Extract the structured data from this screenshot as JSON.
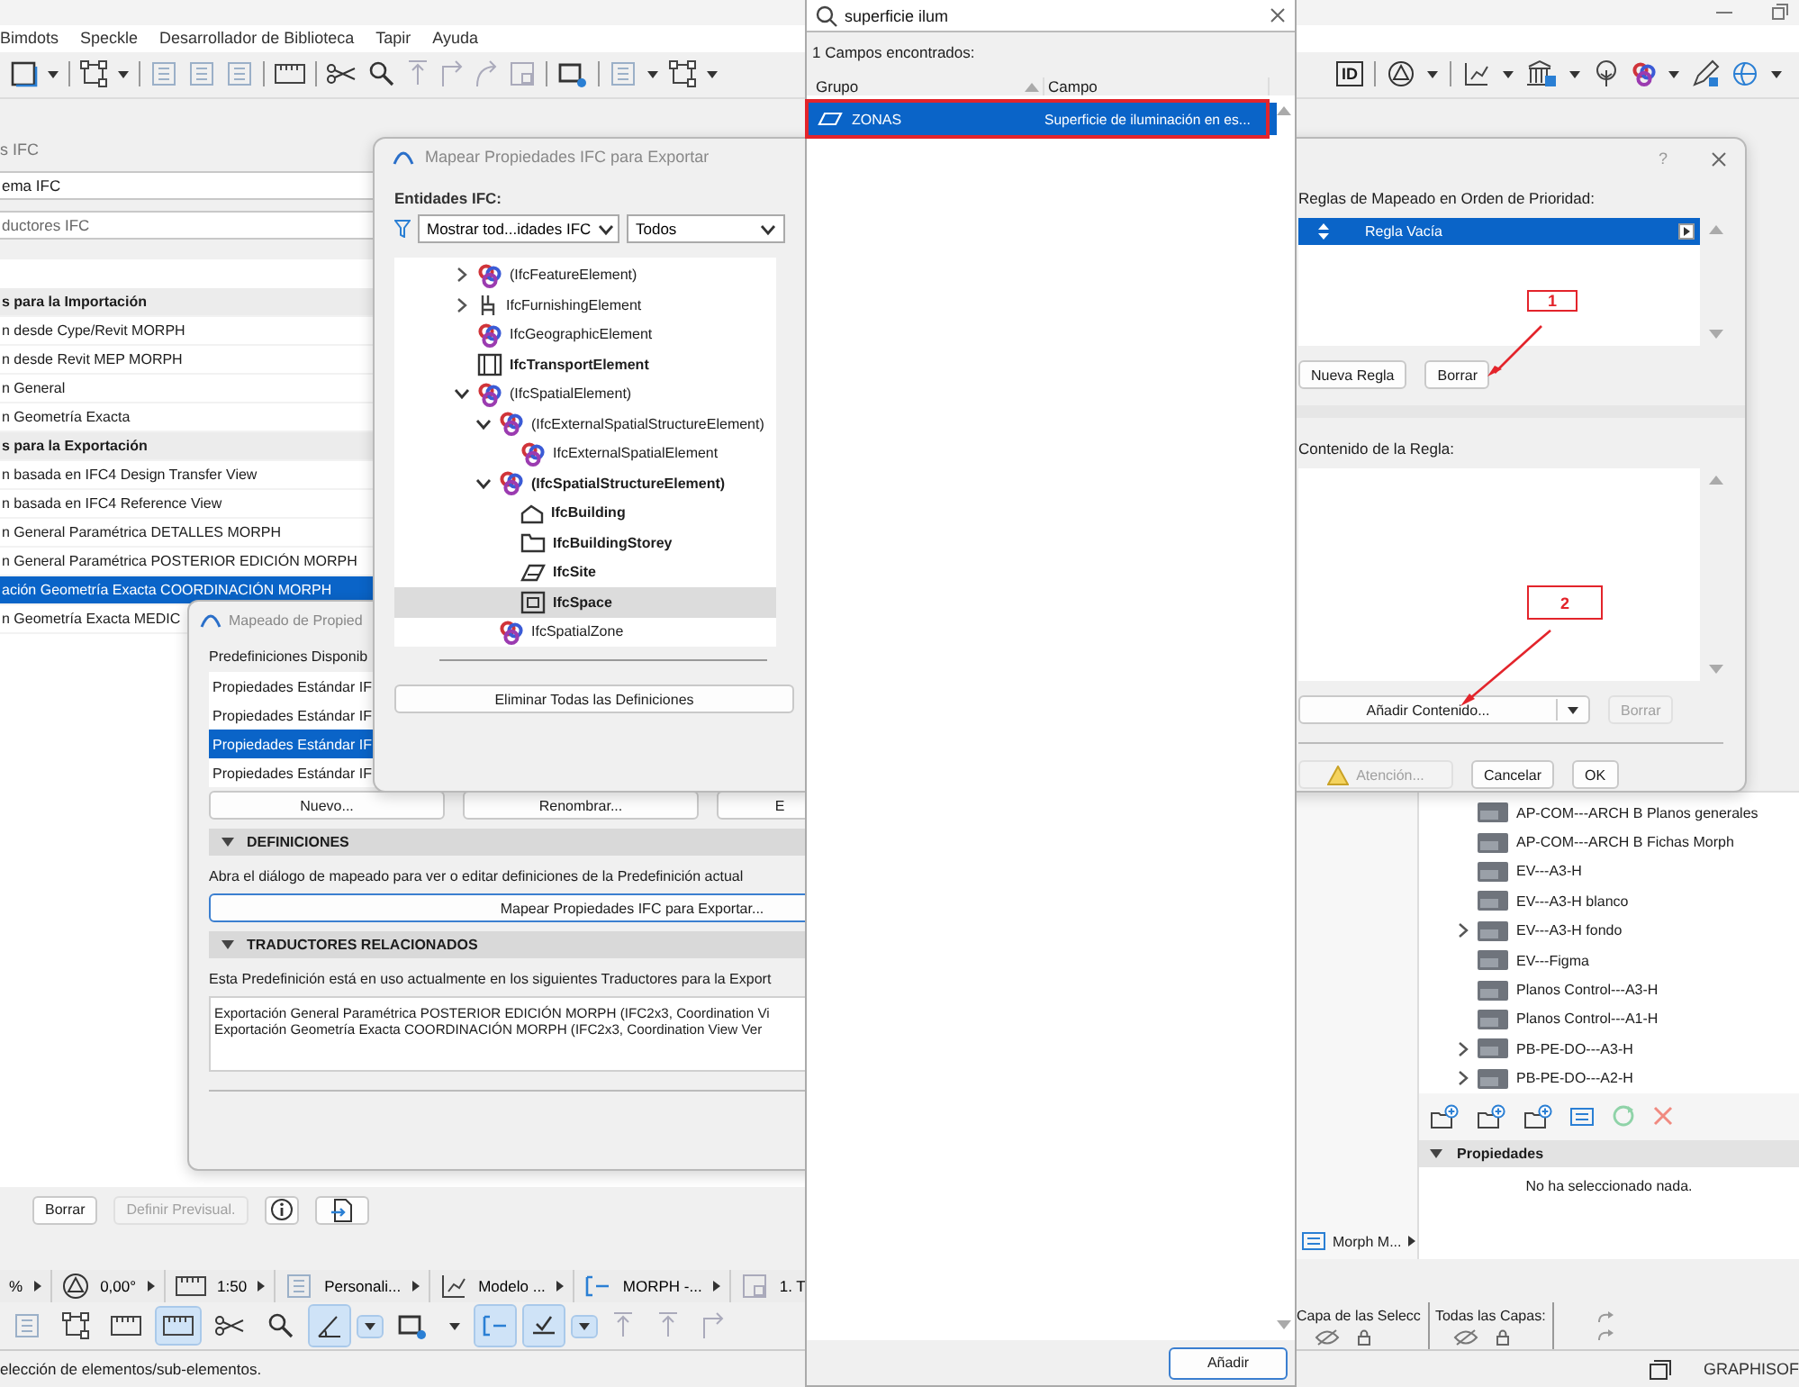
{
  "menu_bar": {
    "items": [
      "Bimdots",
      "Speckle",
      "Desarrollador de Biblioteca",
      "Tapir",
      "Ayuda"
    ]
  },
  "toolbar": {
    "id_button": "ID"
  },
  "ifc_panel": {
    "title": "s IFC",
    "scheme_field": "ema IFC",
    "translators_field": "ductores IFC",
    "rows": [
      {
        "text": "s para la Importación",
        "kind": "header",
        "selected": false
      },
      {
        "text": "n desde Cype/Revit MORPH",
        "kind": "item",
        "selected": false
      },
      {
        "text": "n desde Revit MEP MORPH",
        "kind": "item",
        "selected": false
      },
      {
        "text": "n General",
        "kind": "item",
        "selected": false
      },
      {
        "text": "n Geometría Exacta",
        "kind": "item",
        "selected": false
      },
      {
        "text": "s para la Exportación",
        "kind": "header",
        "selected": false
      },
      {
        "text": "n basada en IFC4 Design Transfer View",
        "kind": "item",
        "selected": false
      },
      {
        "text": "n basada en IFC4 Reference View",
        "kind": "item",
        "selected": false
      },
      {
        "text": "n General Paramétrica DETALLES MORPH",
        "kind": "item",
        "selected": false
      },
      {
        "text": "n General Paramétrica POSTERIOR EDICIÓN MORPH",
        "kind": "item",
        "selected": false
      },
      {
        "text": "ación Geometría Exacta COORDINACIÓN MORPH",
        "kind": "item",
        "selected": true
      },
      {
        "text": "n Geometría Exacta MEDIC",
        "kind": "item",
        "selected": false
      }
    ],
    "buttons": [
      {
        "label": "Borrar",
        "disabled": false
      },
      {
        "label": "Definir Previsual.",
        "disabled": true
      }
    ]
  },
  "mapping_dialog": {
    "title": "Mapeado de Propied",
    "presets_label": "Predefiniciones Disponib",
    "presets": [
      {
        "text": "Propiedades Estándar IF",
        "selected": false
      },
      {
        "text": "Propiedades Estándar IF",
        "selected": false
      },
      {
        "text": "Propiedades Estándar IF",
        "selected": true
      },
      {
        "text": "Propiedades Estándar IF",
        "selected": false
      }
    ],
    "buttons": [
      "Nuevo...",
      "Renombrar...",
      "E"
    ],
    "definitions": {
      "title": "DEFINICIONES",
      "expanded": true,
      "text": "Abra el diálogo de mapeado para ver o editar definiciones de la Predefinición actual",
      "button": "Mapear Propiedades IFC para Exportar..."
    },
    "related": {
      "title": "TRADUCTORES RELACIONADOS",
      "expanded": true,
      "text": "Esta Predefinición está en uso actualmente en los siguientes Traductores para la Export",
      "translators": [
        "Exportación General Paramétrica POSTERIOR EDICIÓN MORPH (IFC2x3, Coordination Vi",
        "Exportación Geometría Exacta COORDINACIÓN MORPH (IFC2x3, Coordination View Ver"
      ]
    }
  },
  "mapear_window": {
    "title": "Mapear Propiedades IFC para Exportar",
    "entities_label": "Entidades IFC:",
    "filter": "Mostrar tod...idades IFC",
    "scope": "Todos",
    "tree": [
      {
        "text": "(IfcFeatureElement)",
        "kind": "entity",
        "bold": false,
        "selected": false,
        "expanded": false
      },
      {
        "text": "IfcFurnishingElement",
        "kind": "furnishing",
        "bold": false,
        "selected": false,
        "expanded": false
      },
      {
        "text": "IfcGeographicElement",
        "kind": "entity",
        "bold": false,
        "selected": false
      },
      {
        "text": "IfcTransportElement",
        "kind": "transport",
        "bold": true,
        "selected": false
      },
      {
        "text": "(IfcSpatialElement)",
        "kind": "entity",
        "bold": false,
        "selected": false,
        "expanded": true,
        "children": [
          {
            "text": "(IfcExternalSpatialStructureElement)",
            "kind": "entity",
            "bold": false,
            "selected": false,
            "expanded": true,
            "children": [
              {
                "text": "IfcExternalSpatialElement",
                "kind": "entity",
                "bold": false,
                "selected": false
              }
            ]
          },
          {
            "text": "(IfcSpatialStructureElement)",
            "kind": "entity",
            "bold": true,
            "selected": false,
            "expanded": true,
            "children": [
              {
                "text": "IfcBuilding",
                "kind": "building",
                "bold": true,
                "selected": false
              },
              {
                "text": "IfcBuildingStorey",
                "kind": "storey",
                "bold": true,
                "selected": false
              },
              {
                "text": "IfcSite",
                "kind": "site",
                "bold": true,
                "selected": false
              },
              {
                "text": "IfcSpace",
                "kind": "space",
                "bold": true,
                "selected": true
              }
            ]
          },
          {
            "text": "IfcSpatialZone",
            "kind": "entity",
            "bold": false,
            "selected": false
          }
        ]
      }
    ],
    "button": "Eliminar Todas las Definiciones"
  },
  "search_popup": {
    "query": "superficie ilum",
    "count": "1 Campos encontrados:",
    "columns": [
      {
        "label": "Grupo",
        "sorted": true
      },
      {
        "label": "Campo",
        "sorted": false
      }
    ],
    "results": [
      {
        "group": "ZONAS",
        "field": "Superficie de iluminación en es...",
        "selected": true,
        "highlighted": true
      }
    ],
    "button": "Añadir"
  },
  "rule_dialog": {
    "help": "?",
    "rules_label": "Reglas de Mapeado en Orden de Prioridad:",
    "rules": [
      {
        "text": "Regla Vacía",
        "selected": true
      }
    ],
    "rule_buttons": [
      {
        "label": "Nueva Regla",
        "disabled": false
      },
      {
        "label": "Borrar",
        "disabled": false
      }
    ],
    "content_label": "Contenido de la Regla:",
    "content_buttons": [
      {
        "label": "Añadir Contenido...",
        "disabled": false
      },
      {
        "label": "Borrar",
        "disabled": true
      }
    ],
    "footer_buttons": [
      {
        "label": "Atención...",
        "disabled": true
      },
      {
        "label": "Cancelar",
        "disabled": false
      },
      {
        "label": "OK",
        "disabled": false
      }
    ]
  },
  "annotations": [
    {
      "label": "1"
    },
    {
      "label": "2"
    }
  ],
  "navigator": {
    "items": [
      {
        "text": "AP-COM---ARCH B Planos generales"
      },
      {
        "text": "AP-COM---ARCH B Fichas Morph"
      },
      {
        "text": "EV---A3-H"
      },
      {
        "text": "EV---A3-H blanco"
      },
      {
        "text": "EV---A3-H fondo",
        "expanded": false
      },
      {
        "text": "EV---Figma"
      },
      {
        "text": "Planos Control---A3-H"
      },
      {
        "text": "Planos Control---A1-H"
      },
      {
        "text": "PB-PE-DO---A3-H",
        "expanded": false
      },
      {
        "text": "PB-PE-DO---A2-H",
        "expanded": false
      }
    ],
    "properties": {
      "title": "Propiedades",
      "expanded": true,
      "text": "No ha seleccionado nada."
    },
    "morph_menu": "Morph M..."
  },
  "view_bar": [
    {
      "text": "%"
    },
    {
      "text": "0,00°"
    },
    {
      "text": "1:50"
    },
    {
      "text": "Personali..."
    },
    {
      "text": "Modelo ..."
    },
    {
      "text": "MORPH -..."
    },
    {
      "text": "1. T"
    }
  ],
  "edit_toolbar": [
    {
      "on": false
    },
    {
      "on": false
    },
    {
      "on": false
    },
    {
      "on": true
    },
    {
      "on": false
    },
    {
      "on": false
    },
    {
      "on": true
    },
    {
      "on": true
    },
    {
      "on": false
    },
    {
      "on": false
    },
    {
      "on": true
    },
    {
      "on": true
    },
    {
      "on": true
    },
    {
      "on": false
    },
    {
      "on": false
    },
    {
      "on": false
    }
  ],
  "layers": {
    "selection_label": "Capa de las Selecc",
    "all_label": "Todas las Capas:"
  },
  "status_bar": {
    "text": "elección de elementos/sub-elementos.",
    "brand": "GRAPHISOF"
  }
}
